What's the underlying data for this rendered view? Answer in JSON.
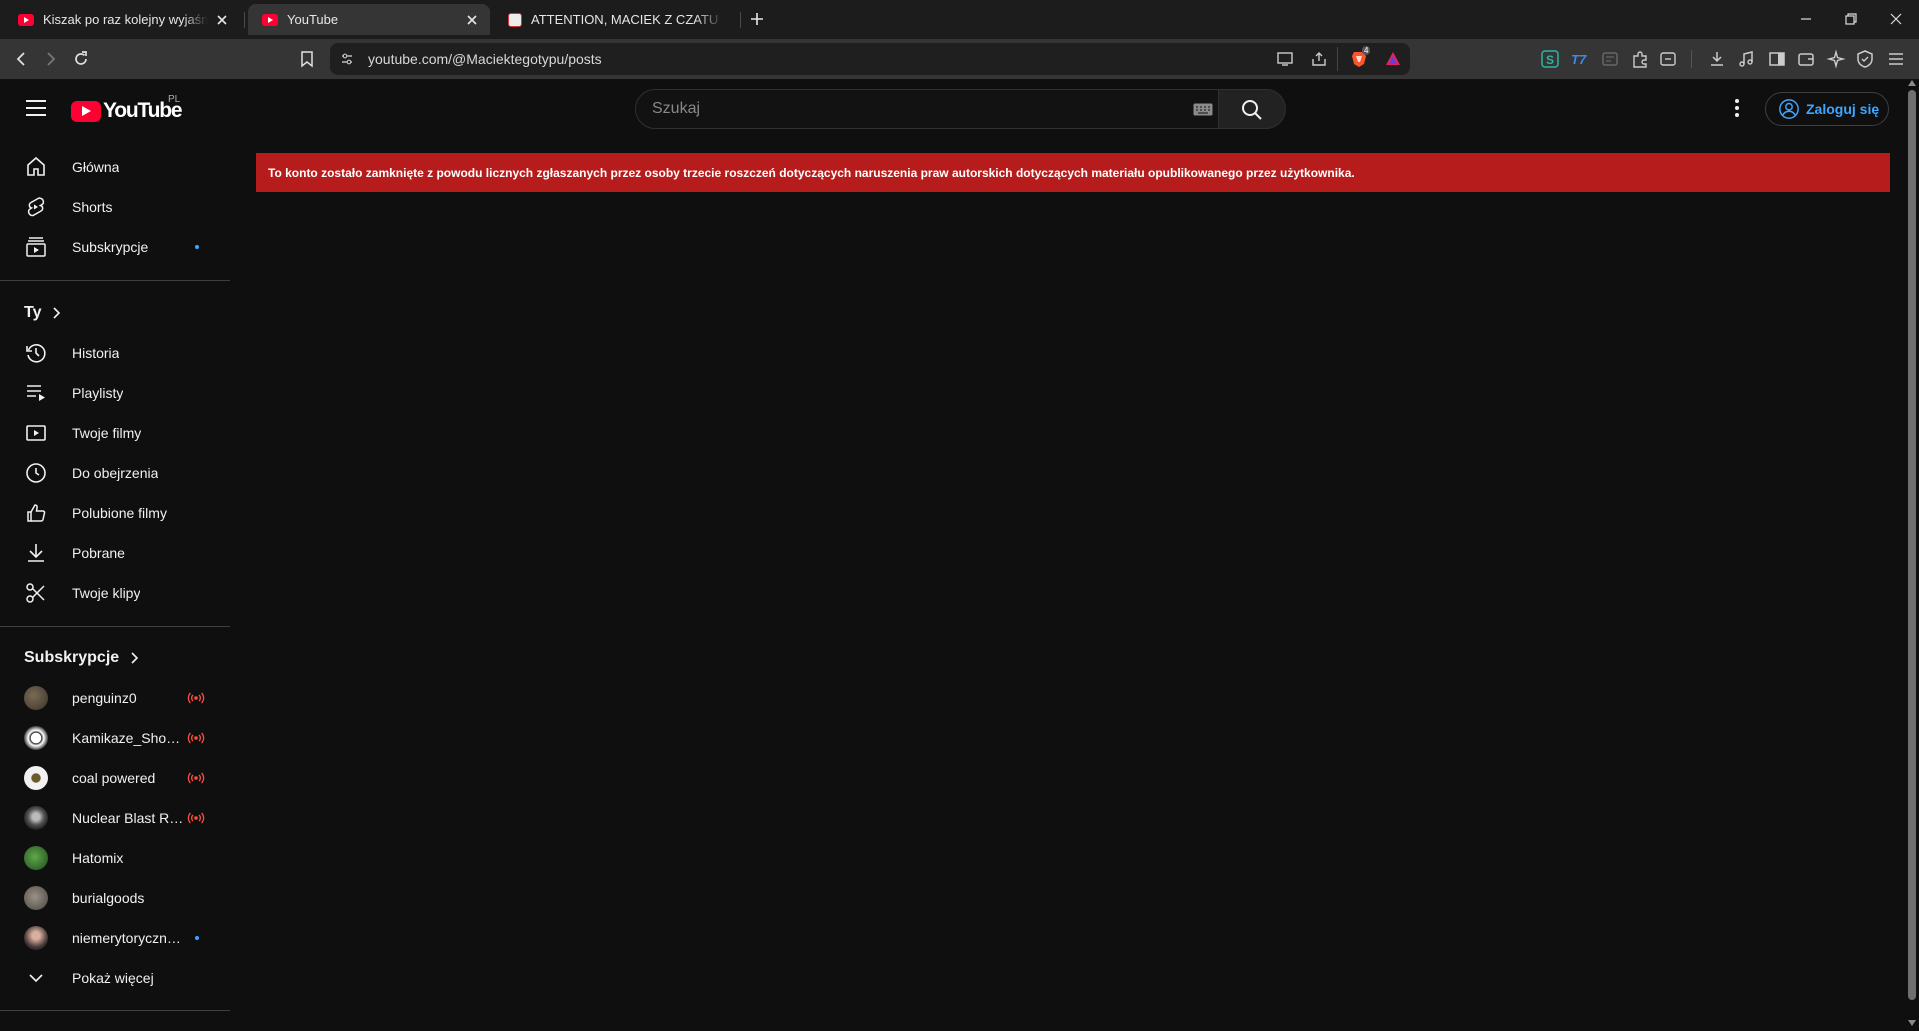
{
  "browser": {
    "tabs": [
      {
        "title": "Kiszak po raz kolejny wyjaśnia Ki"
      },
      {
        "title": "YouTube"
      },
      {
        "title": "ATTENTION, MACIEK Z CZATU JEST K"
      }
    ],
    "url": "youtube.com/@Maciektegotypu/posts",
    "shield_badge": "4"
  },
  "masthead": {
    "logo_text": "YouTube",
    "country_code": "PL",
    "search_placeholder": "Szukaj",
    "sign_in_label": "Zaloguj się"
  },
  "sidebar": {
    "main": [
      {
        "label": "Główna",
        "icon": "home-icon"
      },
      {
        "label": "Shorts",
        "icon": "shorts-icon"
      },
      {
        "label": "Subskrypcje",
        "icon": "subscriptions-icon",
        "has_dot": true
      }
    ],
    "you_header": "Ty",
    "you": [
      {
        "label": "Historia",
        "icon": "history-icon"
      },
      {
        "label": "Playlisty",
        "icon": "playlists-icon"
      },
      {
        "label": "Twoje filmy",
        "icon": "your-videos-icon"
      },
      {
        "label": "Do obejrzenia",
        "icon": "watch-later-icon"
      },
      {
        "label": "Polubione filmy",
        "icon": "liked-videos-icon"
      },
      {
        "label": "Pobrane",
        "icon": "download-icon"
      },
      {
        "label": "Twoje klipy",
        "icon": "clips-icon"
      }
    ],
    "subs_header": "Subskrypcje",
    "subscriptions": [
      {
        "name": "penguinz0",
        "indicator": "live"
      },
      {
        "name": "Kamikaze_Short...",
        "indicator": "live"
      },
      {
        "name": "coal powered",
        "indicator": "live"
      },
      {
        "name": "Nuclear Blast Re...",
        "indicator": "live"
      },
      {
        "name": "Hatomix",
        "indicator": "none"
      },
      {
        "name": "burialgoods",
        "indicator": "none"
      },
      {
        "name": "niemerytoryczne ...",
        "indicator": "dot"
      }
    ],
    "show_more": "Pokaż więcej"
  },
  "alert": {
    "message": "To konto zostało zamknięte z powodu licznych zgłaszanych przez osoby trzecie roszczeń dotyczących naruszenia praw autorskich dotyczących materiału opublikowanego przez użytkownika."
  },
  "colors": {
    "background": "#0f0f0f",
    "alert": "#b71c1c",
    "accent_blue": "#3ea6ff",
    "youtube_red": "#ff0033",
    "live_red": "#ff4e45"
  }
}
